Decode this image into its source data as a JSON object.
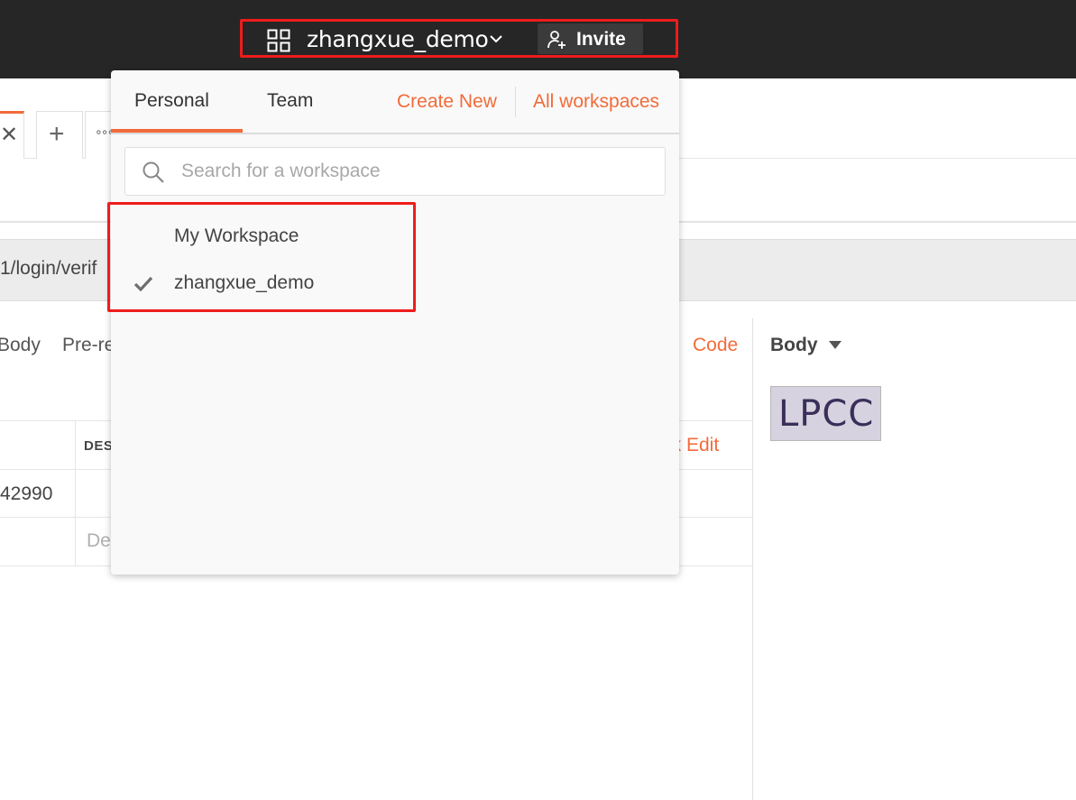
{
  "header": {
    "workspace_name": "zhangxue_demo",
    "invite_label": "Invite"
  },
  "background": {
    "url_fragment": "1/login/verif",
    "request_tabs": [
      "Body",
      "Pre-re"
    ],
    "code_link": "Code",
    "table_header_desc": "DES",
    "bulk_edit": "lk Edit",
    "cell_value": "42990",
    "cell_placeholder": "De",
    "response_tab": "Body",
    "captcha_text": "LPCC"
  },
  "dropdown": {
    "tabs": [
      "Personal",
      "Team"
    ],
    "active_tab": "Personal",
    "create_new": "Create New",
    "all_workspaces": "All workspaces",
    "search_placeholder": "Search for a workspace",
    "workspaces": [
      {
        "name": "My Workspace",
        "selected": false
      },
      {
        "name": "zhangxue_demo",
        "selected": true
      }
    ]
  },
  "colors": {
    "accent": "#f26b3a",
    "highlight_border": "#ee1c1c",
    "header_bg": "#262626"
  }
}
